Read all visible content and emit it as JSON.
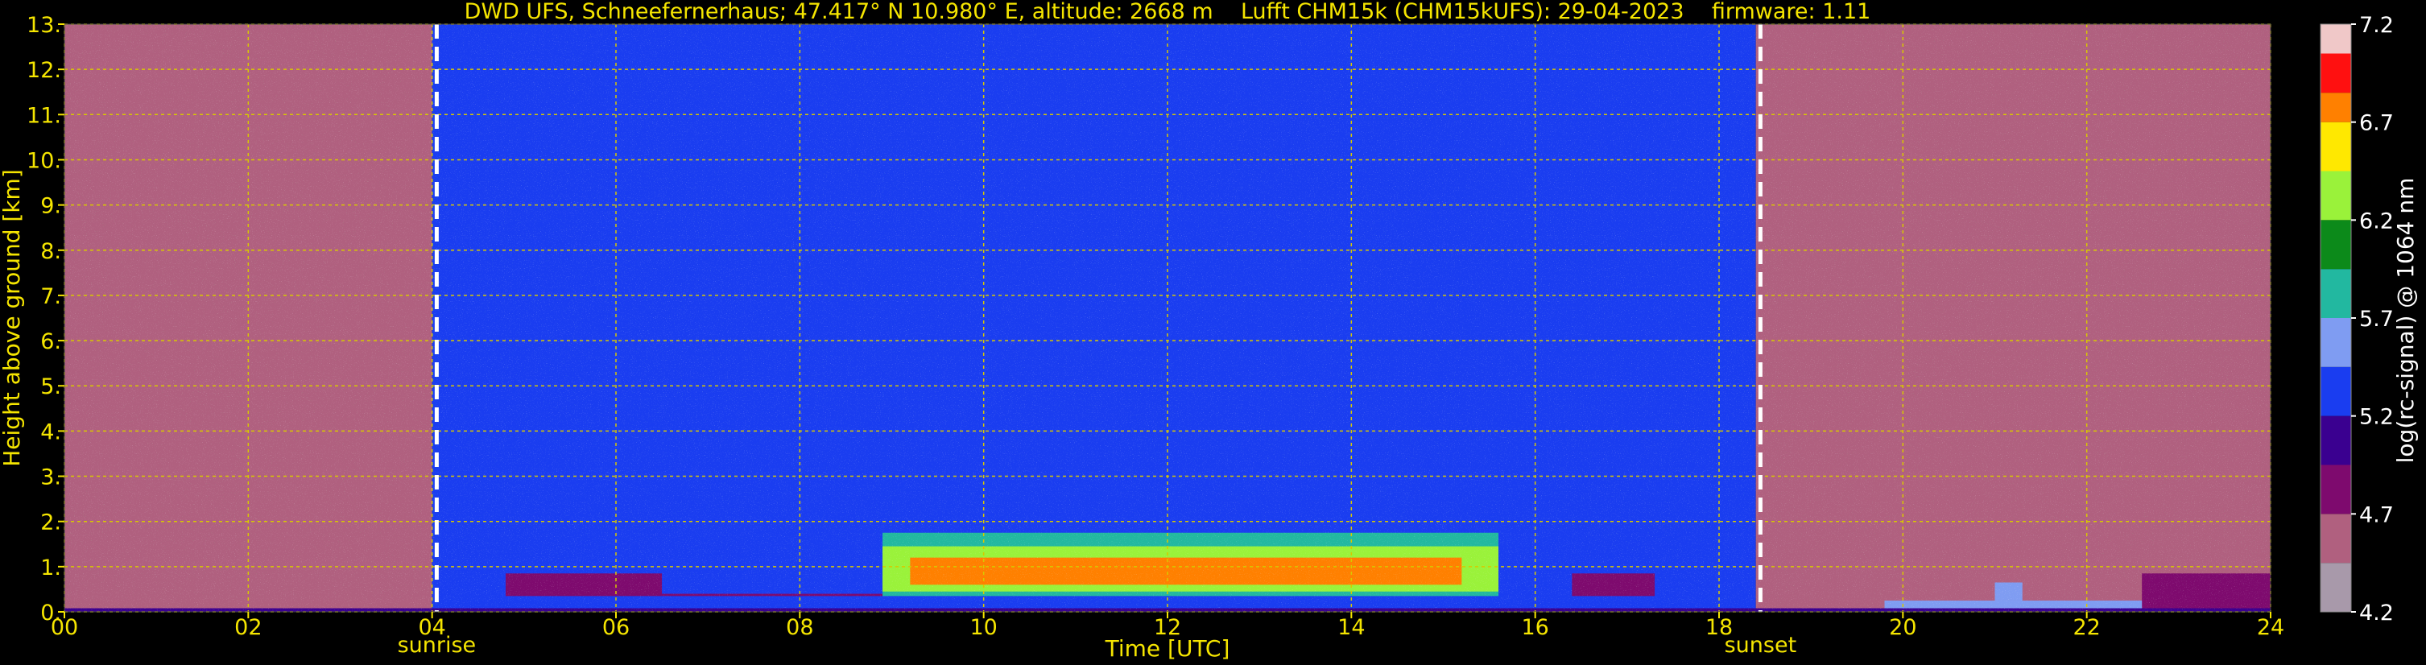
{
  "chart_data": {
    "type": "heatmap",
    "title": "DWD UFS, Schneefernerhaus; 47.417° N 10.980° E, altitude: 2668 m    Lufft CHM15k (CHM15kUFS): 29-04-2023    firmware: 1.11",
    "xlabel": "Time [UTC]",
    "ylabel": "Height above ground [km]",
    "xlim": [
      0,
      24
    ],
    "ylim": [
      0,
      13
    ],
    "x_ticks": [
      "00",
      "02",
      "04",
      "06",
      "08",
      "10",
      "12",
      "14",
      "16",
      "18",
      "20",
      "22",
      "24"
    ],
    "y_ticks": [
      "0.",
      "1.",
      "2.",
      "3.",
      "4.",
      "5.",
      "6.",
      "7.",
      "8.",
      "9.",
      "10.",
      "11.",
      "12.",
      "13."
    ],
    "grid": true,
    "annotations": [
      {
        "label": "sunrise",
        "x": 4.05
      },
      {
        "label": "sunset",
        "x": 18.45
      }
    ],
    "colorbar": {
      "label": "log(rc-signal) @ 1064 nm",
      "range": [
        4.2,
        7.2
      ],
      "ticks": [
        "7.2",
        "6.7",
        "6.2",
        "5.7",
        "5.2",
        "4.7",
        "4.2"
      ]
    },
    "layers": [
      {
        "t0": 0.0,
        "t1": 4.0,
        "h0": 0.0,
        "h1": 13.0,
        "level": 4.55
      },
      {
        "t0": 4.0,
        "t1": 18.4,
        "h0": 0.0,
        "h1": 13.0,
        "level": 5.25
      },
      {
        "t0": 18.4,
        "t1": 24.0,
        "h0": 0.0,
        "h1": 13.0,
        "level": 4.55
      },
      {
        "t0": 4.8,
        "t1": 8.9,
        "h0": 0.35,
        "h1": 0.85,
        "level": 4.9
      },
      {
        "t0": 6.5,
        "t1": 8.9,
        "h0": 0.4,
        "h1": 1.2,
        "level": 5.3
      },
      {
        "t0": 8.9,
        "t1": 15.6,
        "h0": 0.35,
        "h1": 1.75,
        "level": 5.9
      },
      {
        "t0": 8.9,
        "t1": 15.6,
        "h0": 0.45,
        "h1": 1.45,
        "level": 6.3
      },
      {
        "t0": 9.2,
        "t1": 15.2,
        "h0": 0.6,
        "h1": 1.2,
        "level": 6.75
      },
      {
        "t0": 15.6,
        "t1": 16.4,
        "h0": 0.5,
        "h1": 1.4,
        "level": 5.3
      },
      {
        "t0": 16.4,
        "t1": 17.3,
        "h0": 0.35,
        "h1": 0.85,
        "level": 4.9
      },
      {
        "t0": 22.6,
        "t1": 24.0,
        "h0": 0.0,
        "h1": 0.85,
        "level": 4.85
      },
      {
        "t0": 19.8,
        "t1": 22.6,
        "h0": 0.0,
        "h1": 0.25,
        "level": 5.5
      },
      {
        "t0": 21.0,
        "t1": 21.3,
        "h0": 0.25,
        "h1": 0.65,
        "level": 5.6
      },
      {
        "t0": 0.0,
        "t1": 24.0,
        "h0": 0.0,
        "h1": 0.08,
        "level": 5.0
      }
    ]
  }
}
